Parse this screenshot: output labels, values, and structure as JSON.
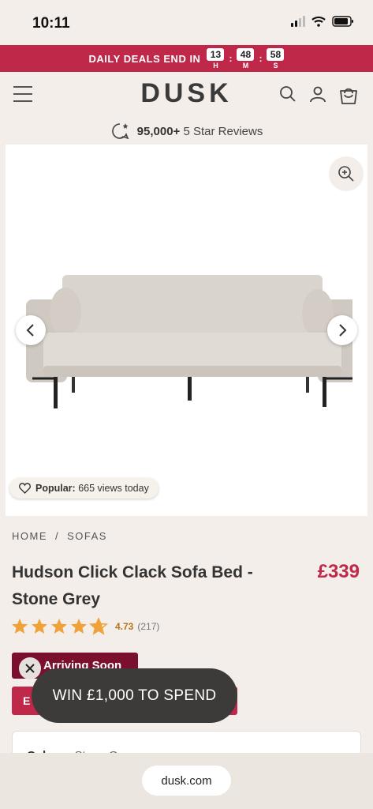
{
  "status_bar": {
    "time": "10:11"
  },
  "deals": {
    "text": "DAILY DEALS END IN",
    "timer": [
      {
        "value": "13",
        "label": "H"
      },
      {
        "value": "48",
        "label": "M"
      },
      {
        "value": "58",
        "label": "S"
      }
    ],
    "separator": ":"
  },
  "header": {
    "logo": "DUSK"
  },
  "reviews": {
    "count": "95,000+",
    "text": "5 Star Reviews"
  },
  "product_image": {
    "popular_label": "Popular:",
    "popular_text": "665 views today"
  },
  "breadcrumb": {
    "items": [
      "HOME",
      "SOFAS"
    ],
    "separator": "/"
  },
  "product": {
    "title": "Hudson Click Clack Sofa Bed - Stone Grey",
    "price": "£339",
    "rating_value": "4.73",
    "rating_count": "(217)",
    "stars": 4.73
  },
  "badges": {
    "arriving": "Arriving Soon",
    "second": "E"
  },
  "popup": {
    "text": "WIN £1,000 TO SPEND"
  },
  "options": {
    "label": "Colour",
    "value": "Stone Grey"
  },
  "browser": {
    "url": "dusk.com"
  },
  "colors": {
    "brand": "#c0284a",
    "dark_brand": "#7a0f2e",
    "background": "#f3eeea",
    "star": "#f0a23a"
  }
}
